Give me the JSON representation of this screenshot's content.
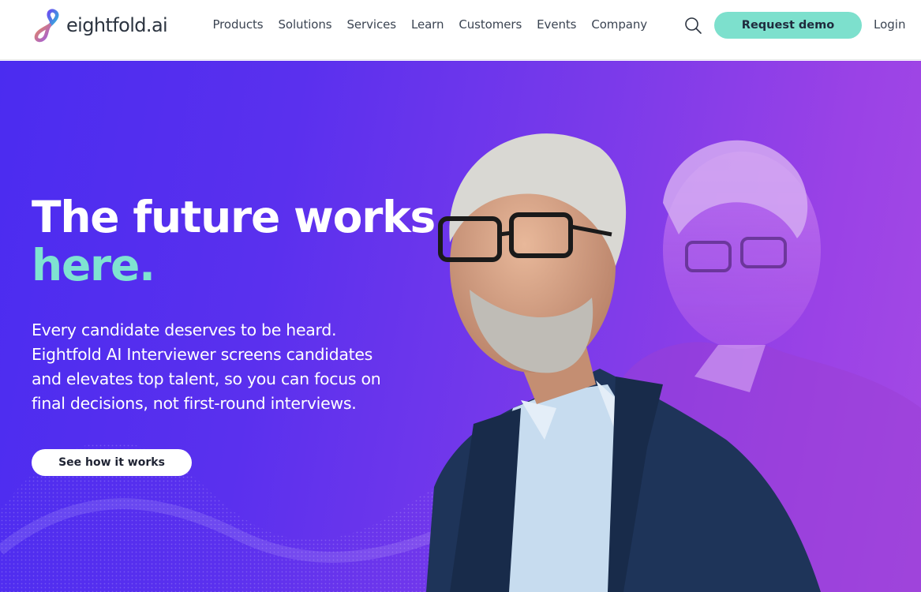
{
  "header": {
    "logo_text": "eightfold.ai",
    "nav": [
      "Products",
      "Solutions",
      "Services",
      "Learn",
      "Customers",
      "Events",
      "Company"
    ],
    "search_icon": "search-icon",
    "cta_label": "Request demo",
    "login_label": "Login"
  },
  "hero": {
    "title_line1": "The future works",
    "title_line2": "here.",
    "body": "Every candidate deserves to be heard. Eightfold AI Interviewer screens candidates and elevates top talent, so you can focus on final decisions, not first-round interviews.",
    "cta_label": "See how it works",
    "image": "hero-portrait-man-with-glasses"
  },
  "colors": {
    "accent": "#7de0cd",
    "hero_gradient_start": "#4b2cf0",
    "hero_gradient_end": "#a44ae4",
    "text_dark": "#3b4452"
  }
}
